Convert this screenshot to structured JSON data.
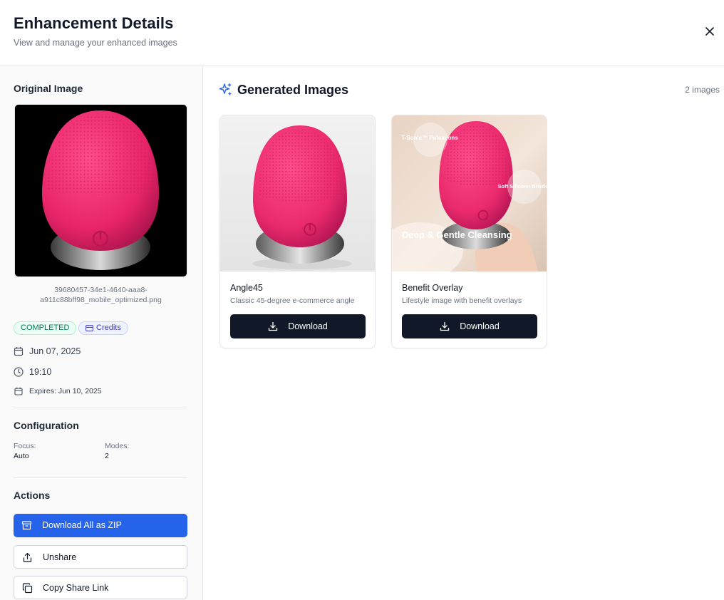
{
  "header": {
    "title": "Enhancement Details",
    "subtitle": "View and manage your enhanced images"
  },
  "sidebar": {
    "original_title": "Original Image",
    "filename": "39680457-34e1-4640-aaa8-a911c88bff98_mobile_optimized.png",
    "status_badge": "COMPLETED",
    "credits_badge": "Credits",
    "date": "Jun 07, 2025",
    "time": "19:10",
    "expires": "Expires: Jun 10, 2025",
    "config_title": "Configuration",
    "focus_label": "Focus:",
    "focus_value": "Auto",
    "modes_label": "Modes:",
    "modes_value": "2",
    "actions_title": "Actions",
    "actions": {
      "zip": "Download All as ZIP",
      "unshare": "Unshare",
      "copy": "Copy Share Link"
    }
  },
  "main": {
    "title": "Generated Images",
    "count": "2 images",
    "cards": [
      {
        "name": "Angle45",
        "desc": "Classic 45-degree e-commerce angle",
        "download": "Download"
      },
      {
        "name": "Benefit Overlay",
        "desc": "Lifestyle image with benefit overlays",
        "download": "Download",
        "overlay_1": "T-Sonic™ Pulsations",
        "overlay_2": "Soft Silicone Bristles",
        "overlay_3": "Deep & Gentle Cleansing"
      }
    ]
  },
  "colors": {
    "accent": "#2563eb",
    "dark_button": "#111827",
    "product_pink": "#ee2a6d",
    "status_green": "#047857"
  },
  "icons": {
    "close": "close-icon",
    "sparkle": "sparkle-icon",
    "calendar": "calendar-icon",
    "clock": "clock-icon",
    "download": "download-icon",
    "archive": "archive-icon",
    "share": "share-icon",
    "copy": "copy-icon",
    "card": "card-icon"
  }
}
